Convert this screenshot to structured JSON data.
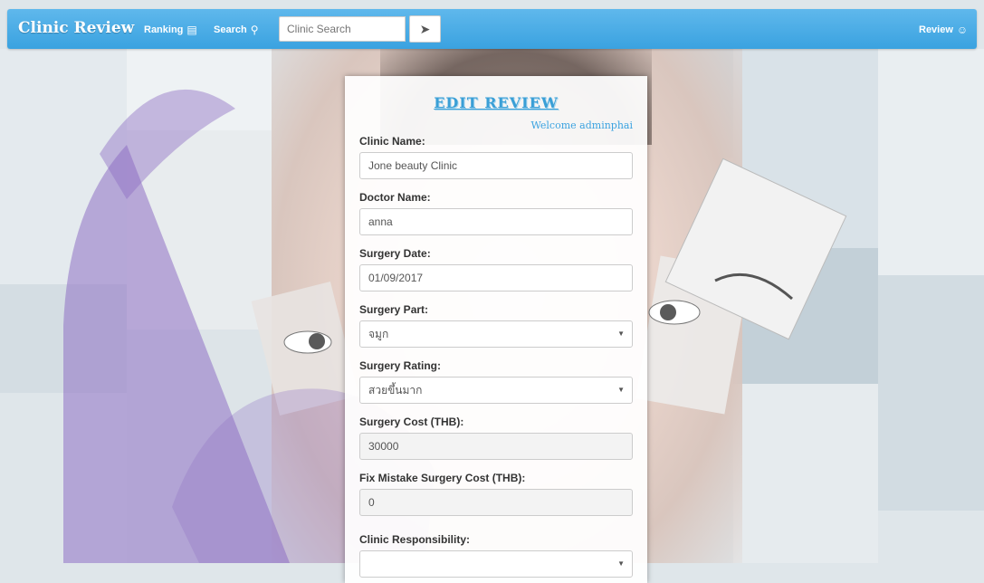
{
  "navbar": {
    "brand": "Clinic Review",
    "ranking_label": "Ranking",
    "search_label": "Search",
    "search_placeholder": "Clinic Search",
    "review_label": "Review"
  },
  "form": {
    "title": "EDIT REVIEW",
    "welcome": "Welcome adminphai",
    "clinic_name_label": "Clinic Name:",
    "clinic_name_value": "Jone beauty Clinic",
    "doctor_name_label": "Doctor Name:",
    "doctor_name_value": "anna",
    "surgery_date_label": "Surgery Date:",
    "surgery_date_value": "01/09/2017",
    "surgery_part_label": "Surgery Part:",
    "surgery_part_value": "จมูก",
    "surgery_rating_label": "Surgery Rating:",
    "surgery_rating_value": "สวยขึ้นมาก",
    "surgery_cost_label": "Surgery Cost (THB):",
    "surgery_cost_value": "30000",
    "fix_cost_label": "Fix Mistake Surgery Cost (THB):",
    "fix_cost_value": "0",
    "responsibility_label": "Clinic Responsibility:"
  },
  "colors": {
    "navbar": "#3aa2e0",
    "title": "#3a9fd6",
    "watermark": "#8e6fc4"
  }
}
